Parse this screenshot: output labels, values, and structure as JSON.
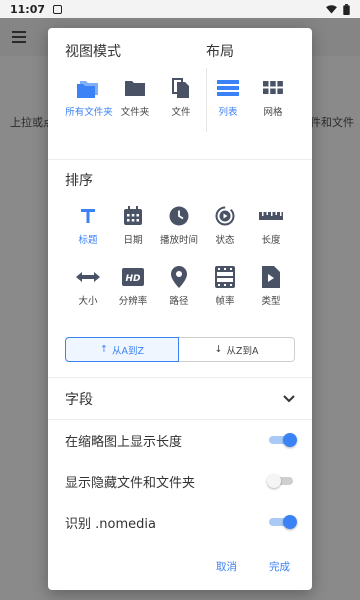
{
  "status": {
    "time": "11:07"
  },
  "background": {
    "hint_left": "上拉或点",
    "hint_right": "件和文件"
  },
  "dialog": {
    "view_mode": {
      "title": "视图模式",
      "options": [
        {
          "label": "所有文件夹",
          "icon": "folders-icon",
          "active": true
        },
        {
          "label": "文件夹",
          "icon": "folder-icon",
          "active": false
        },
        {
          "label": "文件",
          "icon": "files-icon",
          "active": false
        }
      ]
    },
    "layout": {
      "title": "布局",
      "options": [
        {
          "label": "列表",
          "icon": "list-icon",
          "active": true
        },
        {
          "label": "网格",
          "icon": "grid-icon",
          "active": false
        }
      ]
    },
    "sort": {
      "title": "排序",
      "options": [
        {
          "label": "标题",
          "icon": "title-icon",
          "active": true
        },
        {
          "label": "日期",
          "icon": "calendar-icon",
          "active": false
        },
        {
          "label": "播放时间",
          "icon": "clock-icon",
          "active": false
        },
        {
          "label": "状态",
          "icon": "status-icon",
          "active": false
        },
        {
          "label": "长度",
          "icon": "ruler-icon",
          "active": false
        },
        {
          "label": "大小",
          "icon": "size-icon",
          "active": false
        },
        {
          "label": "分辨率",
          "icon": "hd-icon",
          "active": false
        },
        {
          "label": "路径",
          "icon": "location-icon",
          "active": false
        },
        {
          "label": "帧率",
          "icon": "film-icon",
          "active": false
        },
        {
          "label": "类型",
          "icon": "filetype-icon",
          "active": false
        }
      ],
      "asc_label": "从A到Z",
      "desc_label": "从Z到A"
    },
    "fields_label": "字段",
    "toggles": [
      {
        "label": "在缩略图上显示长度",
        "on": true
      },
      {
        "label": "显示隐藏文件和文件夹",
        "on": false
      },
      {
        "label": "识别 .nomedia",
        "on": true
      }
    ],
    "cancel_label": "取消",
    "done_label": "完成"
  },
  "colors": {
    "accent": "#3b82f6",
    "icon": "#4a5366"
  }
}
